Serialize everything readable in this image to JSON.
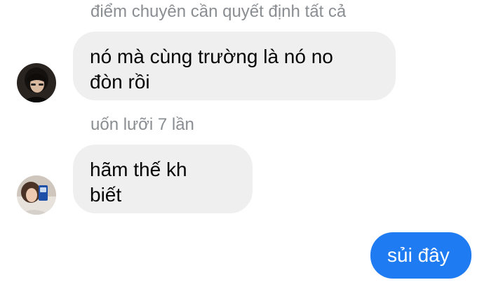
{
  "messages": [
    {
      "sender_label": "điểm chuyên cần quyết định tất cả",
      "lines": [
        "nó mà cùng trường là nó no",
        "đòn rồi"
      ],
      "avatar": "profile-photo-girl-dark-hair"
    },
    {
      "sender_label": "uốn lưỡi 7 lần",
      "lines": [
        "hãm thế kh",
        "biết"
      ],
      "avatar": "profile-photo-girl-with-phone"
    }
  ],
  "outgoing": {
    "text": "sủi đây"
  },
  "colors": {
    "incoming_bubble": "#efefef",
    "outgoing_bubble": "#1f7bf2",
    "label": "#8a8d91"
  }
}
